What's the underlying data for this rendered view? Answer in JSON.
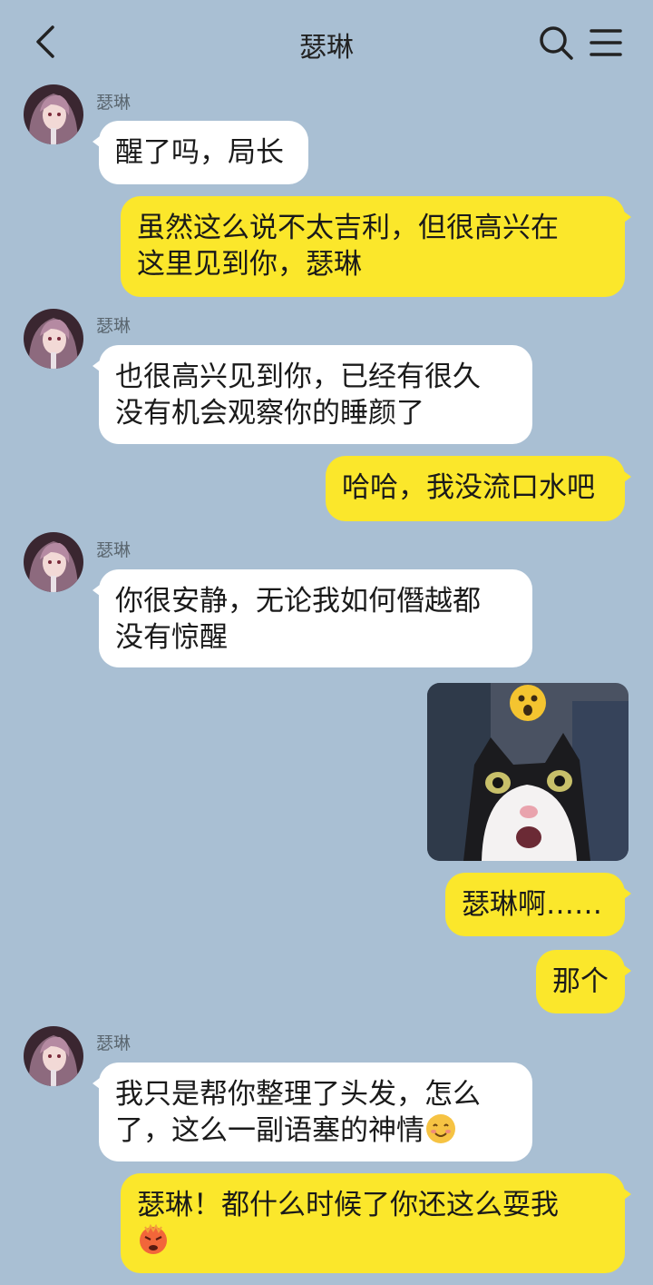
{
  "header": {
    "title": "瑟琳",
    "back_icon": "chevron-left-icon",
    "search_icon": "search-icon",
    "menu_icon": "menu-icon"
  },
  "contact": {
    "name": "瑟琳"
  },
  "messages": [
    {
      "side": "left",
      "sender": "瑟琳",
      "text": "醒了吗，局长"
    },
    {
      "side": "right",
      "text": "虽然这么说不太吉利，但很高兴在\n这里见到你，瑟琳"
    },
    {
      "side": "left",
      "sender": "瑟琳",
      "text": "也很高兴见到你，已经有很久\n没有机会观察你的睡颜了"
    },
    {
      "side": "right",
      "text": "哈哈，我没流口水吧"
    },
    {
      "side": "left",
      "sender": "瑟琳",
      "text": "你很安静，无论我如何僭越都\n没有惊醒"
    },
    {
      "side": "right",
      "type": "sticker",
      "sticker": "surprised-cat-sticker"
    },
    {
      "side": "right",
      "text": "瑟琳啊……"
    },
    {
      "side": "right",
      "text": "那个"
    },
    {
      "side": "left",
      "sender": "瑟琳",
      "text": "我只是帮你整理了头发，怎么\n了，这么一副语塞的神情",
      "emoji": "smiling-blush-emoji"
    },
    {
      "side": "right",
      "text": "瑟琳！都什么时候了你还这么耍我",
      "emoji": "angry-face-emoji"
    }
  ],
  "colors": {
    "background": "#a9bfd3",
    "incoming_bubble": "#ffffff",
    "outgoing_bubble": "#fbe72b"
  }
}
